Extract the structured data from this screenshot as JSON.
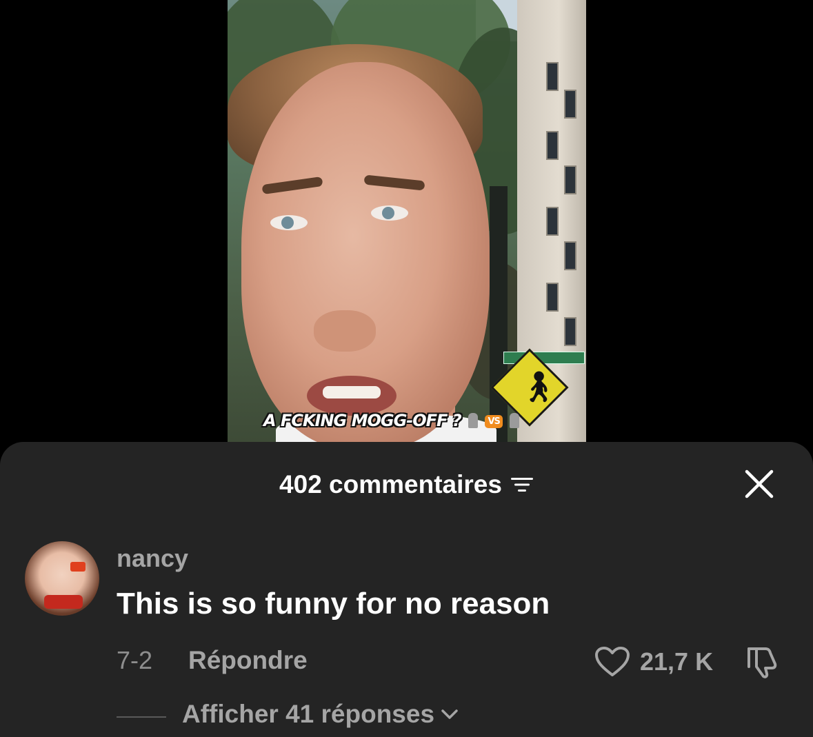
{
  "video": {
    "caption_text": "A FCKING MOGG-OFF ?",
    "caption_badge": "VS",
    "caption_emoji": "moai-icon"
  },
  "comments_panel": {
    "count_title": "402 commentaires",
    "filter_icon": "sort-filter-icon",
    "close_icon": "close-icon",
    "comments": [
      {
        "username": "nancy",
        "text": "This is so funny for no reason",
        "date": "7-2",
        "reply_label": "Répondre",
        "like_count": "21,7 K",
        "like_icon": "heart-outline-icon",
        "dislike_icon": "thumbs-down-icon",
        "view_replies_label": "Afficher 41 réponses",
        "view_replies_icon": "chevron-down-icon"
      }
    ]
  },
  "colors": {
    "sheet_background": "#242424",
    "primary_text": "#ffffff",
    "secondary_text": "#a5a5a5",
    "muted_text": "#8e8e8e"
  }
}
